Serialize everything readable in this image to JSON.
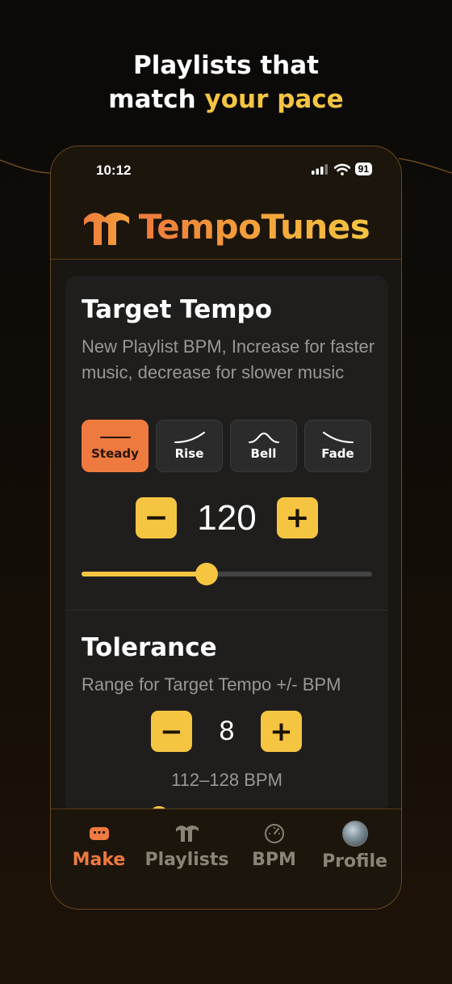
{
  "headline": {
    "line1": "Playlists that",
    "line2_prefix": "match ",
    "line2_accent": "your pace"
  },
  "status_bar": {
    "time": "10:12",
    "battery": "91"
  },
  "brand": {
    "name": "TempoTunes",
    "colors": {
      "orange": "#ef7a3d",
      "yellow": "#f5c542"
    }
  },
  "target_tempo": {
    "title": "Target Tempo",
    "description": "New Playlist BPM, Increase for faster music, decrease for slower music",
    "shapes": [
      {
        "label": "Steady",
        "icon": "flat-line-icon",
        "active": true
      },
      {
        "label": "Rise",
        "icon": "rise-curve-icon",
        "active": false
      },
      {
        "label": "Bell",
        "icon": "bell-curve-icon",
        "active": false
      },
      {
        "label": "Fade",
        "icon": "fade-curve-icon",
        "active": false
      }
    ],
    "minus": "−",
    "plus": "+",
    "value": "120",
    "slider_fraction": 0.43
  },
  "tolerance": {
    "title": "Tolerance",
    "description": "Range for Target Tempo +/- BPM",
    "minus": "−",
    "plus": "+",
    "value": "8",
    "range": "112–128 BPM"
  },
  "tabs": [
    {
      "label": "Make",
      "icon": "controller-icon",
      "active": true
    },
    {
      "label": "Playlists",
      "icon": "tempotunes-logo-icon",
      "active": false
    },
    {
      "label": "BPM",
      "icon": "speedometer-icon",
      "active": false
    },
    {
      "label": "Profile",
      "icon": "avatar",
      "active": false
    }
  ]
}
